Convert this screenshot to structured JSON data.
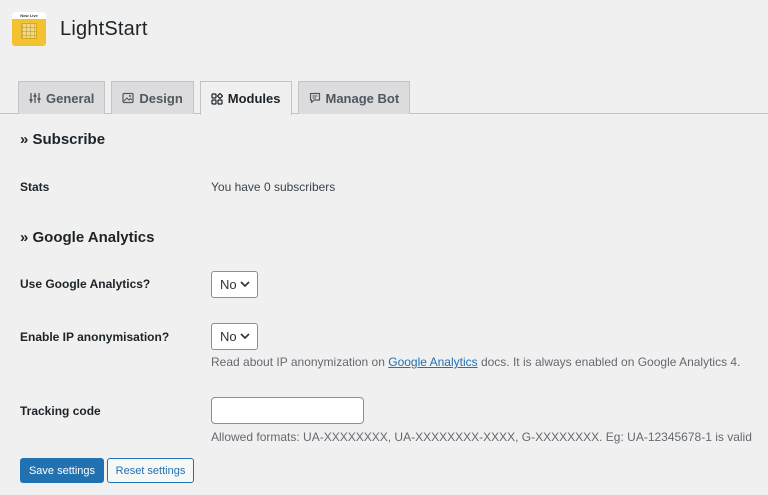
{
  "app": {
    "title": "LightStart",
    "logo_banner": "Now Live"
  },
  "tabs": [
    {
      "label": "General",
      "icon": "sliders-icon",
      "active": false
    },
    {
      "label": "Design",
      "icon": "image-icon",
      "active": false
    },
    {
      "label": "Modules",
      "icon": "modules-icon",
      "active": true
    },
    {
      "label": "Manage Bot",
      "icon": "chat-icon",
      "active": false
    }
  ],
  "subscribe": {
    "heading": "» Subscribe",
    "stats_label": "Stats",
    "stats_value": "You have 0 subscribers"
  },
  "analytics": {
    "heading": "» Google Analytics",
    "use_label": "Use Google Analytics?",
    "use_value": "No",
    "ip_label": "Enable IP anonymisation?",
    "ip_value": "No",
    "ip_help_before": "Read about IP anonymization on ",
    "ip_help_link": "Google Analytics",
    "ip_help_after": " docs. It is always enabled on Google Analytics 4.",
    "tracking_label": "Tracking code",
    "tracking_value": "",
    "tracking_help": "Allowed formats: UA-XXXXXXXX, UA-XXXXXXXX-XXXX, G-XXXXXXXX. Eg: UA-12345678-1 is valid"
  },
  "actions": {
    "save_label": "Save settings",
    "reset_label": "Reset settings"
  },
  "colors": {
    "accent": "#2271b1",
    "background": "#f0f0f1",
    "logo": "#f2c230"
  }
}
